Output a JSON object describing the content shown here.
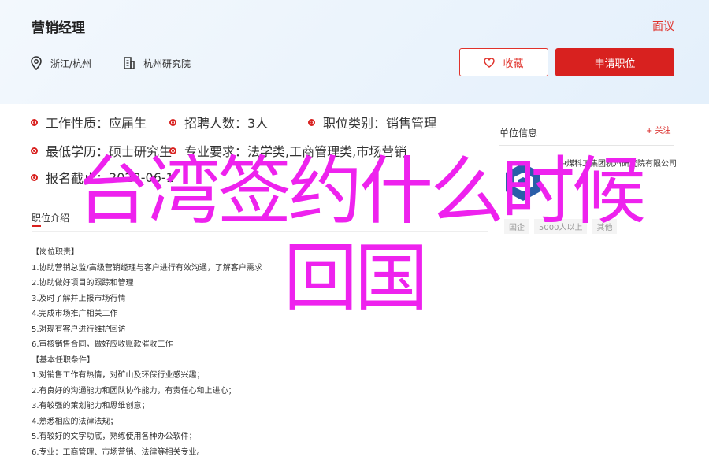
{
  "header": {
    "job_title": "营销经理",
    "report_label": "面议",
    "location": "浙江/杭州",
    "company_short": "杭州研究院",
    "favorite_label": "收藏",
    "apply_label": "申请职位"
  },
  "info": {
    "items": [
      {
        "label": "工作性质：",
        "value": "应届生"
      },
      {
        "label": "招聘人数：",
        "value": "3人"
      },
      {
        "label": "职位类别：",
        "value": "销售管理"
      },
      {
        "label": "最低学历：",
        "value": "硕士研究生"
      },
      {
        "label": "专业要求：",
        "value": "法学类,工商管理类,市场营销"
      },
      {
        "label": "报名截止：",
        "value": "2023-06-1"
      }
    ]
  },
  "sidebar": {
    "title": "单位信息",
    "follow_label": "+ 关注",
    "company_name": "中煤科工集团杭州研究院有限公司",
    "tags": [
      "国企",
      "5000人以上",
      "其他"
    ]
  },
  "description": {
    "title": "职位介绍",
    "lines": [
      "【岗位职责】",
      "1.协助营销总监/高级营销经理与客户进行有效沟通，了解客户需求",
      "2.协助做好项目的跟踪和管理",
      "3.及时了解并上报市场行情",
      "4.完成市场推广相关工作",
      "5.对现有客户进行维护回访",
      "6.审核销售合同，做好应收账款催收工作",
      "【基本任职条件】",
      "1.对销售工作有热情，对矿山及环保行业感兴趣；",
      "2.有良好的沟通能力和团队协作能力，有责任心和上进心；",
      "3.有较强的策划能力和思维创意；",
      "4.熟悉相应的法律法规；",
      "5.有较好的文字功底，熟练使用各种办公软件；",
      "6.专业：工商管理、市场营销、法律等相关专业。"
    ]
  },
  "overlay": {
    "line1": "台湾签约什么时候",
    "line2": "回国"
  },
  "colors": {
    "accent": "#d8211f",
    "overlay": "#ee22ee",
    "header_bg": "#eaf3fc"
  }
}
